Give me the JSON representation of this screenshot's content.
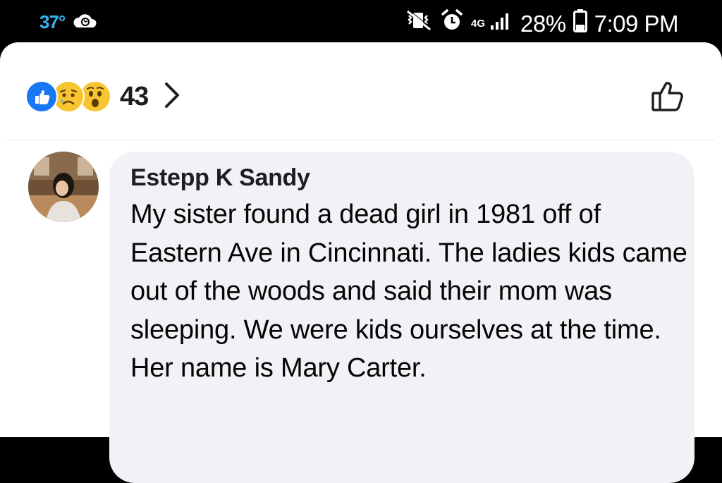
{
  "status_bar": {
    "temperature": "37°",
    "weather_icon": "cloud-icon",
    "network": "4G",
    "battery_percent": "28%",
    "time": "7:09 PM"
  },
  "reactions": {
    "types": [
      "like",
      "sad",
      "wow"
    ],
    "count": "43"
  },
  "comment": {
    "author": "Estepp K Sandy",
    "text": "My sister found a dead girl in 1981 off of Eastern Ave in Cincinnati. The ladies kids came out of the woods and said their mom was sleeping. We were kids ourselves at the time. Her name is Mary Carter."
  },
  "colors": {
    "accent": "#1877f2",
    "bubble": "#f0f2f5",
    "temperature": "#35b4f0"
  }
}
